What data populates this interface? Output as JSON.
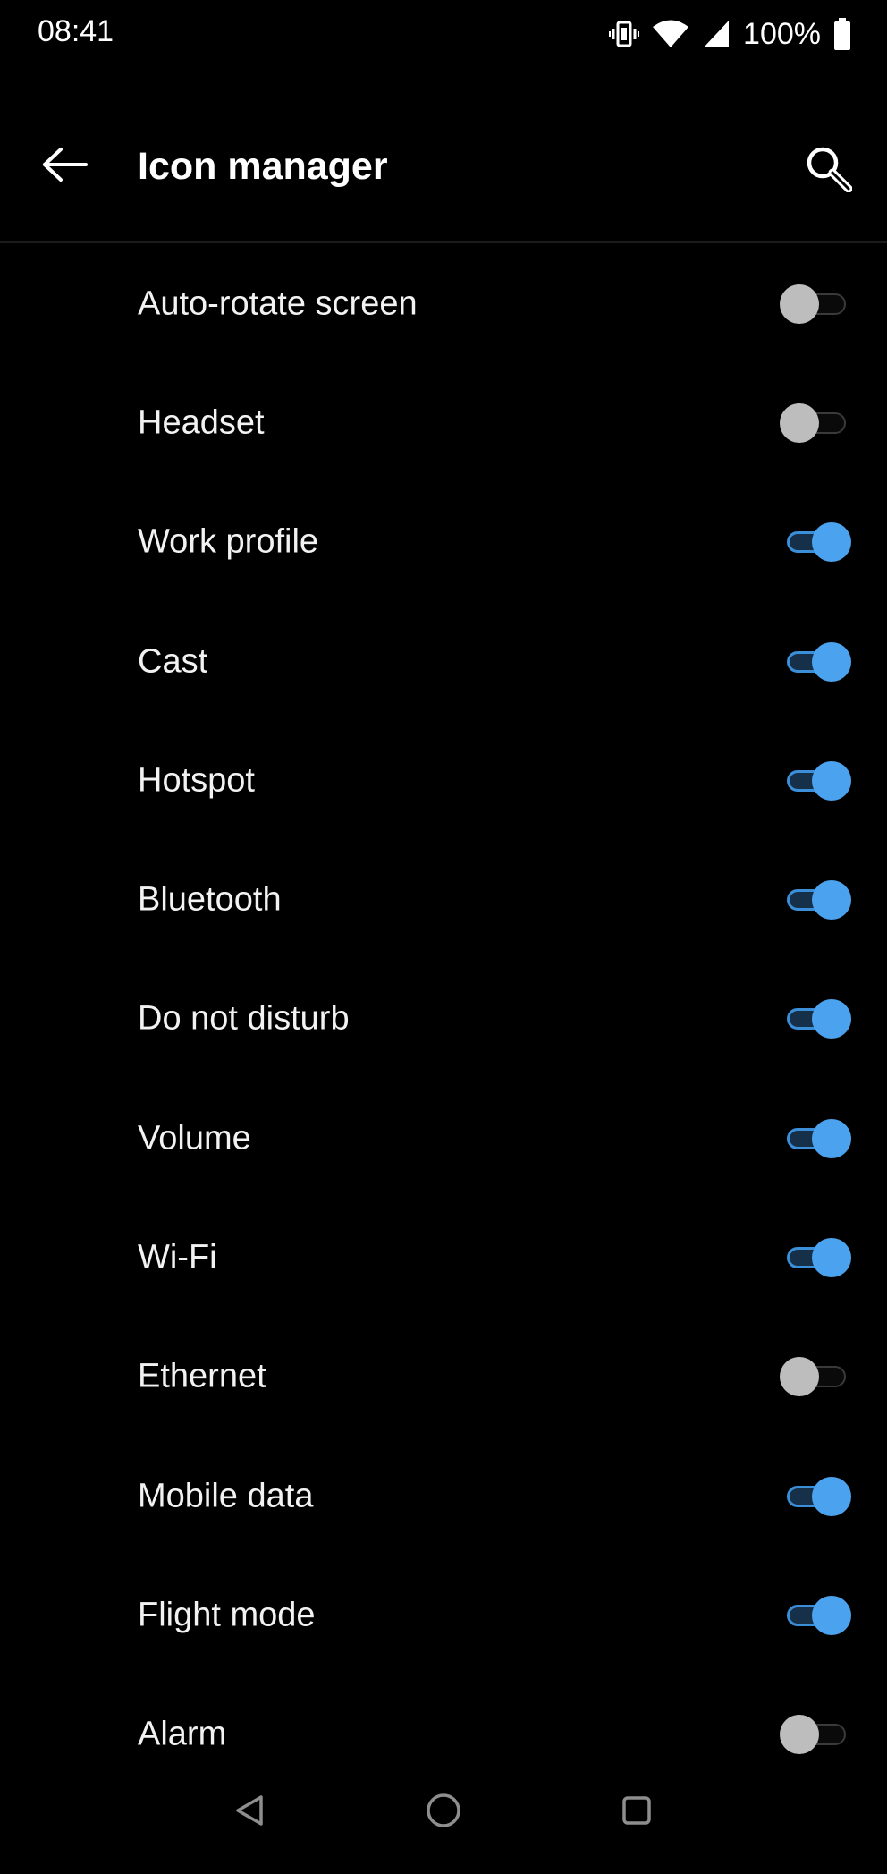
{
  "status_bar": {
    "time": "08:41",
    "battery": "100%",
    "icons": [
      "vibrate-icon",
      "wifi-icon",
      "cellular-signal-icon",
      "battery-icon"
    ]
  },
  "toolbar": {
    "title": "Icon manager",
    "back_icon": "arrow-left-icon",
    "search_icon": "search-icon"
  },
  "colors": {
    "background": "#000000",
    "accent": "#4ba3ef",
    "toggle_off_thumb": "#bdbdbd",
    "text": "#f2f2f2"
  },
  "items": [
    {
      "label": "Auto-rotate screen",
      "enabled": false
    },
    {
      "label": "Headset",
      "enabled": false
    },
    {
      "label": "Work profile",
      "enabled": true
    },
    {
      "label": "Cast",
      "enabled": true
    },
    {
      "label": "Hotspot",
      "enabled": true
    },
    {
      "label": "Bluetooth",
      "enabled": true
    },
    {
      "label": "Do not disturb",
      "enabled": true
    },
    {
      "label": "Volume",
      "enabled": true
    },
    {
      "label": "Wi-Fi",
      "enabled": true
    },
    {
      "label": "Ethernet",
      "enabled": false
    },
    {
      "label": "Mobile data",
      "enabled": true
    },
    {
      "label": "Flight mode",
      "enabled": true
    },
    {
      "label": "Alarm",
      "enabled": false
    }
  ],
  "nav_bar": {
    "buttons": [
      "nav-back-triangle-icon",
      "nav-home-circle-icon",
      "nav-recents-square-icon"
    ]
  }
}
